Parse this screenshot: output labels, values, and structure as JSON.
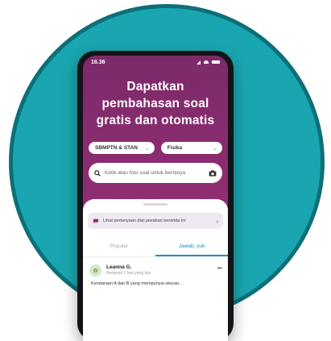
{
  "status": {
    "time": "16.36"
  },
  "headline": "Dapatkan pembahasan soal gratis dan otomatis",
  "filters": {
    "exam": "SBMPTN & STAN",
    "subject": "Fisika"
  },
  "search": {
    "placeholder": "Ketik atau foto soal untuk bertanya"
  },
  "banner": {
    "text": "Lihat pertanyaan dan jawaban beranda ini"
  },
  "tabs": [
    {
      "label": "Populer"
    },
    {
      "label": "Jawab, yuk"
    }
  ],
  "post": {
    "name": "Leanna G.",
    "subtitle": "Bertanya 1 hari yang lalu",
    "text": "Kendaraan A dan B yang mempunyai ukuran..."
  },
  "colors": {
    "badge": "#1aa6b0",
    "brand": "#8e2d72",
    "tab_active": "#1a8fc0"
  }
}
